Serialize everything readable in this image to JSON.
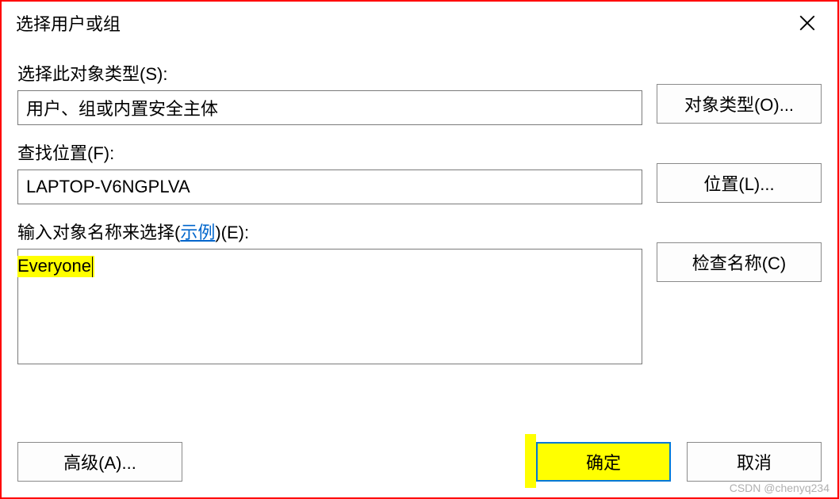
{
  "window": {
    "title": "选择用户或组"
  },
  "fields": {
    "object_type_label": "选择此对象类型(S):",
    "object_type_value": "用户、组或内置安全主体",
    "location_label": "查找位置(F):",
    "location_value": "LAPTOP-V6NGPLVA",
    "names_label_prefix": "输入对象名称来选择(",
    "names_label_link": "示例",
    "names_label_suffix": ")(E):",
    "names_value": "Everyone"
  },
  "buttons": {
    "object_types": "对象类型(O)...",
    "locations": "位置(L)...",
    "check_names": "检查名称(C)",
    "advanced": "高级(A)...",
    "ok": "确定",
    "cancel": "取消"
  },
  "watermark": "CSDN @chenyq234"
}
